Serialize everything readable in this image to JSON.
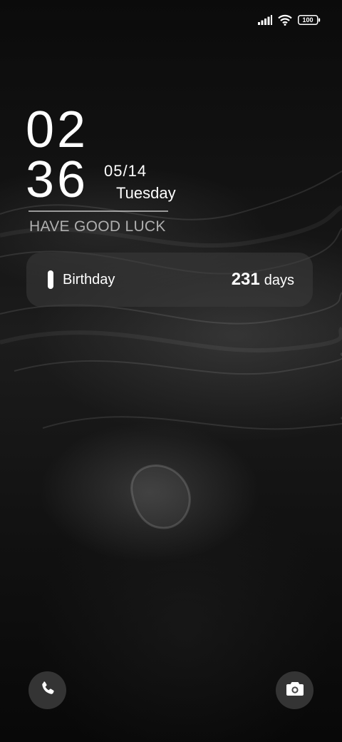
{
  "status_bar": {
    "battery_level": "100",
    "signal_icon": "cellular-signal-icon",
    "wifi_icon": "wifi-icon",
    "battery_icon": "battery-icon"
  },
  "clock": {
    "hours": "02",
    "minutes": "36",
    "date": "05/14",
    "weekday": "Tuesday",
    "motto": "HAVE GOOD LUCK"
  },
  "countdown": {
    "label": "Birthday",
    "number": "231",
    "unit": "days"
  },
  "shortcuts": {
    "left_icon": "phone-icon",
    "right_icon": "camera-icon"
  },
  "colors": {
    "text": "#ffffff",
    "widget_bg": "#3c3c3c",
    "background": "#050505"
  }
}
